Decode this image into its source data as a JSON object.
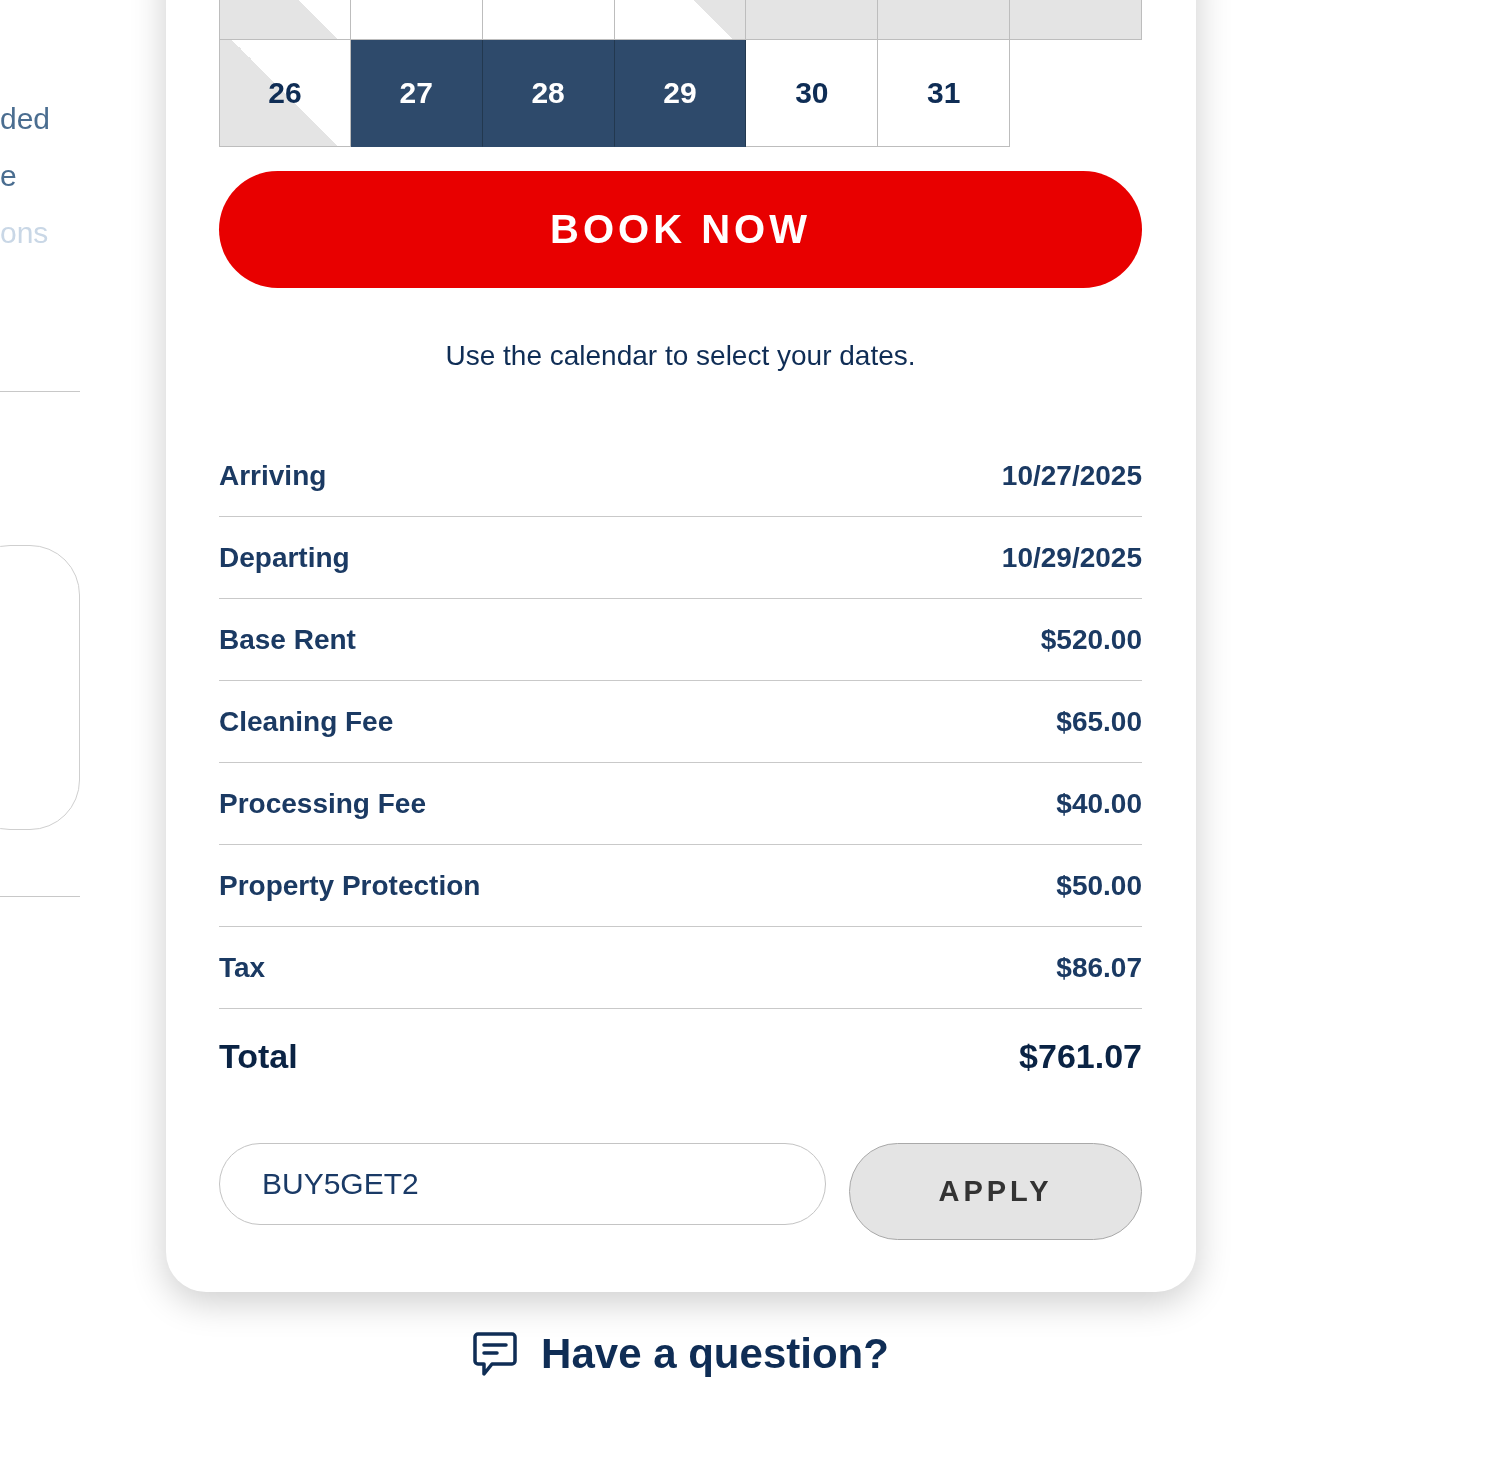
{
  "sidebar": {
    "texts": [
      {
        "text": "ded",
        "muted": false
      },
      {
        "text": "e",
        "muted": false
      },
      {
        "text": "ons",
        "muted": true
      }
    ]
  },
  "booking": {
    "calendar": {
      "weeks": [
        {
          "days": [
            {
              "kind": "checkout",
              "selected": false
            },
            {
              "kind": "available",
              "selected": false
            },
            {
              "kind": "available",
              "selected": false
            },
            {
              "kind": "checkin",
              "selected": false
            },
            {
              "kind": "booked",
              "selected": false
            },
            {
              "kind": "booked",
              "selected": false
            },
            {
              "kind": "booked",
              "selected": false
            }
          ]
        },
        {
          "days": [
            {
              "day": "26",
              "kind": "checkout",
              "selected": false
            },
            {
              "day": "27",
              "kind": "available",
              "selected": true
            },
            {
              "day": "28",
              "kind": "available",
              "selected": true
            },
            {
              "day": "29",
              "kind": "available",
              "selected": true
            },
            {
              "day": "30",
              "kind": "available",
              "selected": false
            },
            {
              "day": "31",
              "kind": "available",
              "selected": false
            }
          ]
        }
      ]
    },
    "book_button": "BOOK NOW",
    "hint": "Use the calendar to select your dates.",
    "summary": [
      {
        "kind": "line",
        "label": "Arriving",
        "value": "10/27/2025"
      },
      {
        "kind": "line",
        "label": "Departing",
        "value": "10/29/2025"
      },
      {
        "kind": "line",
        "label": "Base Rent",
        "value": "$520.00"
      },
      {
        "kind": "line",
        "label": "Cleaning Fee",
        "value": "$65.00"
      },
      {
        "kind": "line",
        "label": "Processing Fee",
        "value": "$40.00"
      },
      {
        "kind": "line",
        "label": "Property Protection",
        "value": "$50.00"
      },
      {
        "kind": "line",
        "label": "Tax",
        "value": "$86.07"
      },
      {
        "kind": "total",
        "label": "Total",
        "value": "$761.07"
      }
    ],
    "coupon": {
      "value": "BUY5GET2",
      "button": "APPLY"
    }
  },
  "help_link": "Have a question?"
}
